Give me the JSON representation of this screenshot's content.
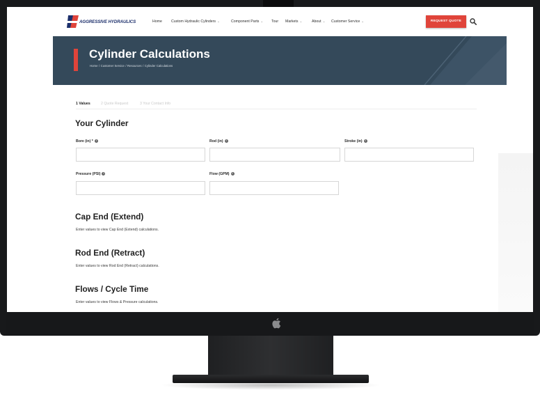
{
  "nav": {
    "logo_text": "AGGRESSIVE HYDRAULICS",
    "items": [
      {
        "label": "Home",
        "has_chevron": false
      },
      {
        "label": "Custom Hydraulic Cylinders",
        "has_chevron": true
      },
      {
        "label": "Component Parts",
        "has_chevron": true
      },
      {
        "label": "Tour",
        "has_chevron": false
      },
      {
        "label": "Markets",
        "has_chevron": true
      },
      {
        "label": "About",
        "has_chevron": true
      },
      {
        "label": "Customer Service",
        "has_chevron": true
      }
    ],
    "chevron": "⌄",
    "cta_label": "REQUEST QUOTE",
    "search_icon": "search-icon"
  },
  "hero": {
    "title": "Cylinder Calculations",
    "breadcrumb": [
      "Home",
      "Customer Service",
      "Resources",
      "Cylinder Calculations"
    ],
    "separator": "/"
  },
  "steps": [
    {
      "label": "1  Values",
      "active": true
    },
    {
      "label": "2  Quote Request",
      "active": false
    },
    {
      "label": "3  Your Contact Info",
      "active": false
    }
  ],
  "form": {
    "section_title": "Your Cylinder",
    "info_glyph": "i",
    "fields": [
      {
        "label": "Bore (in) *",
        "value": ""
      },
      {
        "label": "Rod (in)",
        "value": ""
      },
      {
        "label": "Stroke (in)",
        "value": ""
      },
      {
        "label": "Pressure (PSI)",
        "value": ""
      },
      {
        "label": "Flow (GPM)",
        "value": ""
      }
    ]
  },
  "results": [
    {
      "title": "Cap End (Extend)",
      "description": "Enter values to view Cap End (Extend) calculations."
    },
    {
      "title": "Rod End (Retract)",
      "description": "Enter values to view Rod End (Retract) calculations."
    },
    {
      "title": "Flows / Cycle Time",
      "description": "Enter values to view Flows & Pressure calculations."
    }
  ],
  "colors": {
    "accent_red": "#e0443a",
    "hero_bg": "#34495a",
    "brand_navy": "#1c2f6b",
    "bezel": "#18191b"
  }
}
